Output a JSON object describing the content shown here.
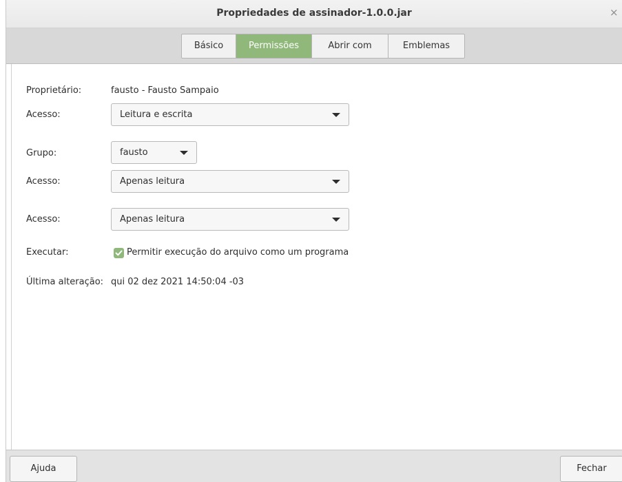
{
  "window": {
    "title": "Propriedades de assinador-1.0.0.jar",
    "close_glyph": "×"
  },
  "tabs": [
    {
      "label": "Básico",
      "active": false
    },
    {
      "label": "Permissões",
      "active": true
    },
    {
      "label": "Abrir com",
      "active": false
    },
    {
      "label": "Emblemas",
      "active": false
    }
  ],
  "permissions": {
    "owner_label": "Proprietário:",
    "owner_value": "fausto - Fausto Sampaio",
    "owner_access_label": "Acesso:",
    "owner_access_value": "Leitura e escrita",
    "group_label": "Grupo:",
    "group_value": "fausto",
    "group_access_label": "Acesso:",
    "group_access_value": "Apenas leitura",
    "others_access_label": "Acesso:",
    "others_access_value": "Apenas leitura",
    "execute_label": "Executar:",
    "execute_checkbox_label": "Permitir execução do arquivo como um programa",
    "execute_checked": true,
    "modified_label": "Última alteração:",
    "modified_value": "qui 02 dez 2021 14:50:04 -03"
  },
  "footer": {
    "help_label": "Ajuda",
    "close_label": "Fechar"
  },
  "colors": {
    "accent": "#8fb87a",
    "tabstrip_bg": "#d8d8d8",
    "footer_bg": "#e3e3e3"
  }
}
